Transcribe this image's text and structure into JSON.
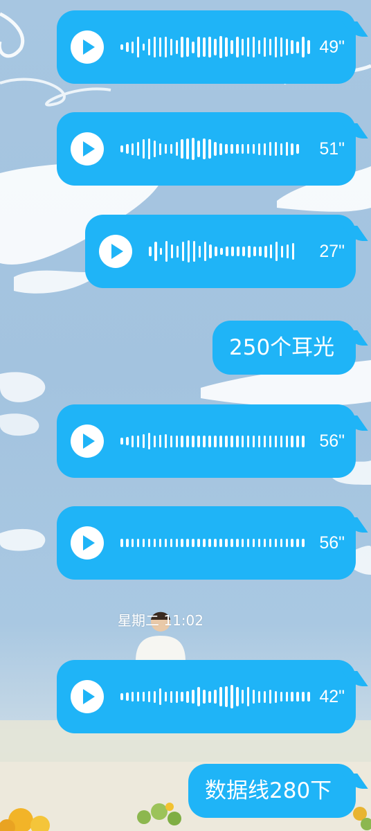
{
  "messages": [
    {
      "kind": "voice",
      "duration": "49\"",
      "levels": [
        0.25,
        0.4,
        0.5,
        0.9,
        0.3,
        0.7,
        0.9,
        0.8,
        0.9,
        0.7,
        0.6,
        0.9,
        0.8,
        0.5,
        0.9,
        0.8,
        0.9,
        0.7,
        0.95,
        0.8,
        0.6,
        0.9,
        0.7,
        0.8,
        0.9,
        0.6,
        0.8,
        0.7,
        0.9,
        0.8,
        0.7,
        0.6,
        0.5,
        0.9,
        0.6
      ]
    },
    {
      "kind": "voice",
      "duration": "51\"",
      "levels": [
        0.3,
        0.4,
        0.5,
        0.6,
        0.8,
        0.9,
        0.7,
        0.5,
        0.4,
        0.4,
        0.6,
        0.8,
        0.9,
        0.95,
        0.7,
        0.9,
        0.8,
        0.6,
        0.5,
        0.4,
        0.4,
        0.4,
        0.4,
        0.4,
        0.4,
        0.5,
        0.5,
        0.6,
        0.6,
        0.5,
        0.6,
        0.5,
        0.4
      ]
    },
    {
      "kind": "voice",
      "duration": "27\"",
      "levels": [
        0.4,
        0.8,
        0.3,
        0.9,
        0.6,
        0.5,
        0.8,
        0.95,
        0.9,
        0.5,
        0.8,
        0.6,
        0.4,
        0.3,
        0.4,
        0.4,
        0.4,
        0.4,
        0.5,
        0.4,
        0.4,
        0.5,
        0.6,
        0.8,
        0.5,
        0.6,
        0.7
      ]
    },
    {
      "kind": "text",
      "text": "250个耳光"
    },
    {
      "kind": "voice",
      "duration": "56\"",
      "levels": [
        0.3,
        0.35,
        0.5,
        0.5,
        0.6,
        0.7,
        0.5,
        0.55,
        0.6,
        0.5,
        0.5,
        0.5,
        0.5,
        0.5,
        0.5,
        0.5,
        0.5,
        0.5,
        0.5,
        0.5,
        0.5,
        0.5,
        0.5,
        0.5,
        0.5,
        0.5,
        0.5,
        0.5,
        0.5,
        0.5,
        0.5,
        0.5,
        0.5,
        0.5
      ]
    },
    {
      "kind": "voice",
      "duration": "56\"",
      "levels": [
        0.35,
        0.35,
        0.35,
        0.35,
        0.35,
        0.35,
        0.35,
        0.35,
        0.35,
        0.35,
        0.35,
        0.35,
        0.35,
        0.35,
        0.35,
        0.35,
        0.35,
        0.35,
        0.35,
        0.35,
        0.35,
        0.35,
        0.35,
        0.35,
        0.35,
        0.35,
        0.35,
        0.35,
        0.35,
        0.35,
        0.35,
        0.35,
        0.35,
        0.35
      ]
    },
    {
      "kind": "voice",
      "duration": "42\"",
      "levels": [
        0.3,
        0.35,
        0.4,
        0.4,
        0.4,
        0.45,
        0.5,
        0.7,
        0.4,
        0.5,
        0.5,
        0.4,
        0.5,
        0.6,
        0.8,
        0.6,
        0.5,
        0.6,
        0.8,
        0.9,
        1.0,
        0.8,
        0.6,
        0.8,
        0.6,
        0.5,
        0.5,
        0.6,
        0.5,
        0.4,
        0.4,
        0.4,
        0.4,
        0.4,
        0.4
      ]
    },
    {
      "kind": "text",
      "text": "数据线280下"
    }
  ],
  "timestamp": "星期二 11:02",
  "colors": {
    "bubble": "#1fb4f7",
    "sky": "#a7c6e1",
    "text": "#ffffff"
  },
  "icons": [
    "play-icon"
  ]
}
